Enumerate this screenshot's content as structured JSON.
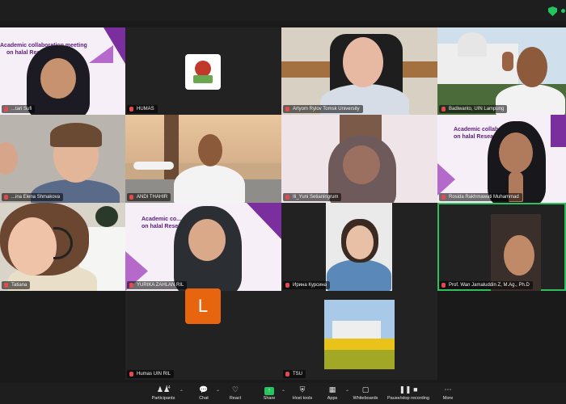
{
  "tiles": [
    {
      "name": "Fitri Utari Sufi",
      "display": "...tari Sufi"
    },
    {
      "name": "HUMAS"
    },
    {
      "name": "Artyom Rylov Tomsk University"
    },
    {
      "name": "Badiwanto, UIN Lampung"
    },
    {
      "name": "...ina Elena Shmakova"
    },
    {
      "name": "ANDI THAHIR"
    },
    {
      "name": "Ili_Yuni Setianingrum"
    },
    {
      "name": "Rosida Rakhmawati Muhammad"
    },
    {
      "name": "Tatiana"
    },
    {
      "name": "YURIKA ZAHLAN RIL"
    },
    {
      "name": "Ирина Курсина"
    },
    {
      "name": "Prof. Wan Jamaluddin Z, M.Ag., Ph.D"
    },
    {
      "name": "Humas UIN RIL"
    },
    {
      "name": "TSU"
    }
  ],
  "banners": {
    "line1": "Academic collaboration meeting",
    "line1_right": "Academic collabora...ing",
    "line2": "on halal Research",
    "line1_mid": "Academic co... ...eting"
  },
  "avatar_letter": "L",
  "toolbar": {
    "participants_label": "Participants",
    "participants_count": "14",
    "chat_label": "Chat",
    "react_label": "React",
    "share_label": "Share",
    "host_tools_label": "Host tools",
    "apps_label": "Apps",
    "whiteboards_label": "Whiteboards",
    "record_label": "Pause/stop recording",
    "more_label": "More"
  },
  "colors": {
    "accent_purple": "#7b2e9e",
    "active_speaker": "#2fbf5f",
    "mic_muted": "#e5484d",
    "avatar_orange": "#e8650f"
  }
}
